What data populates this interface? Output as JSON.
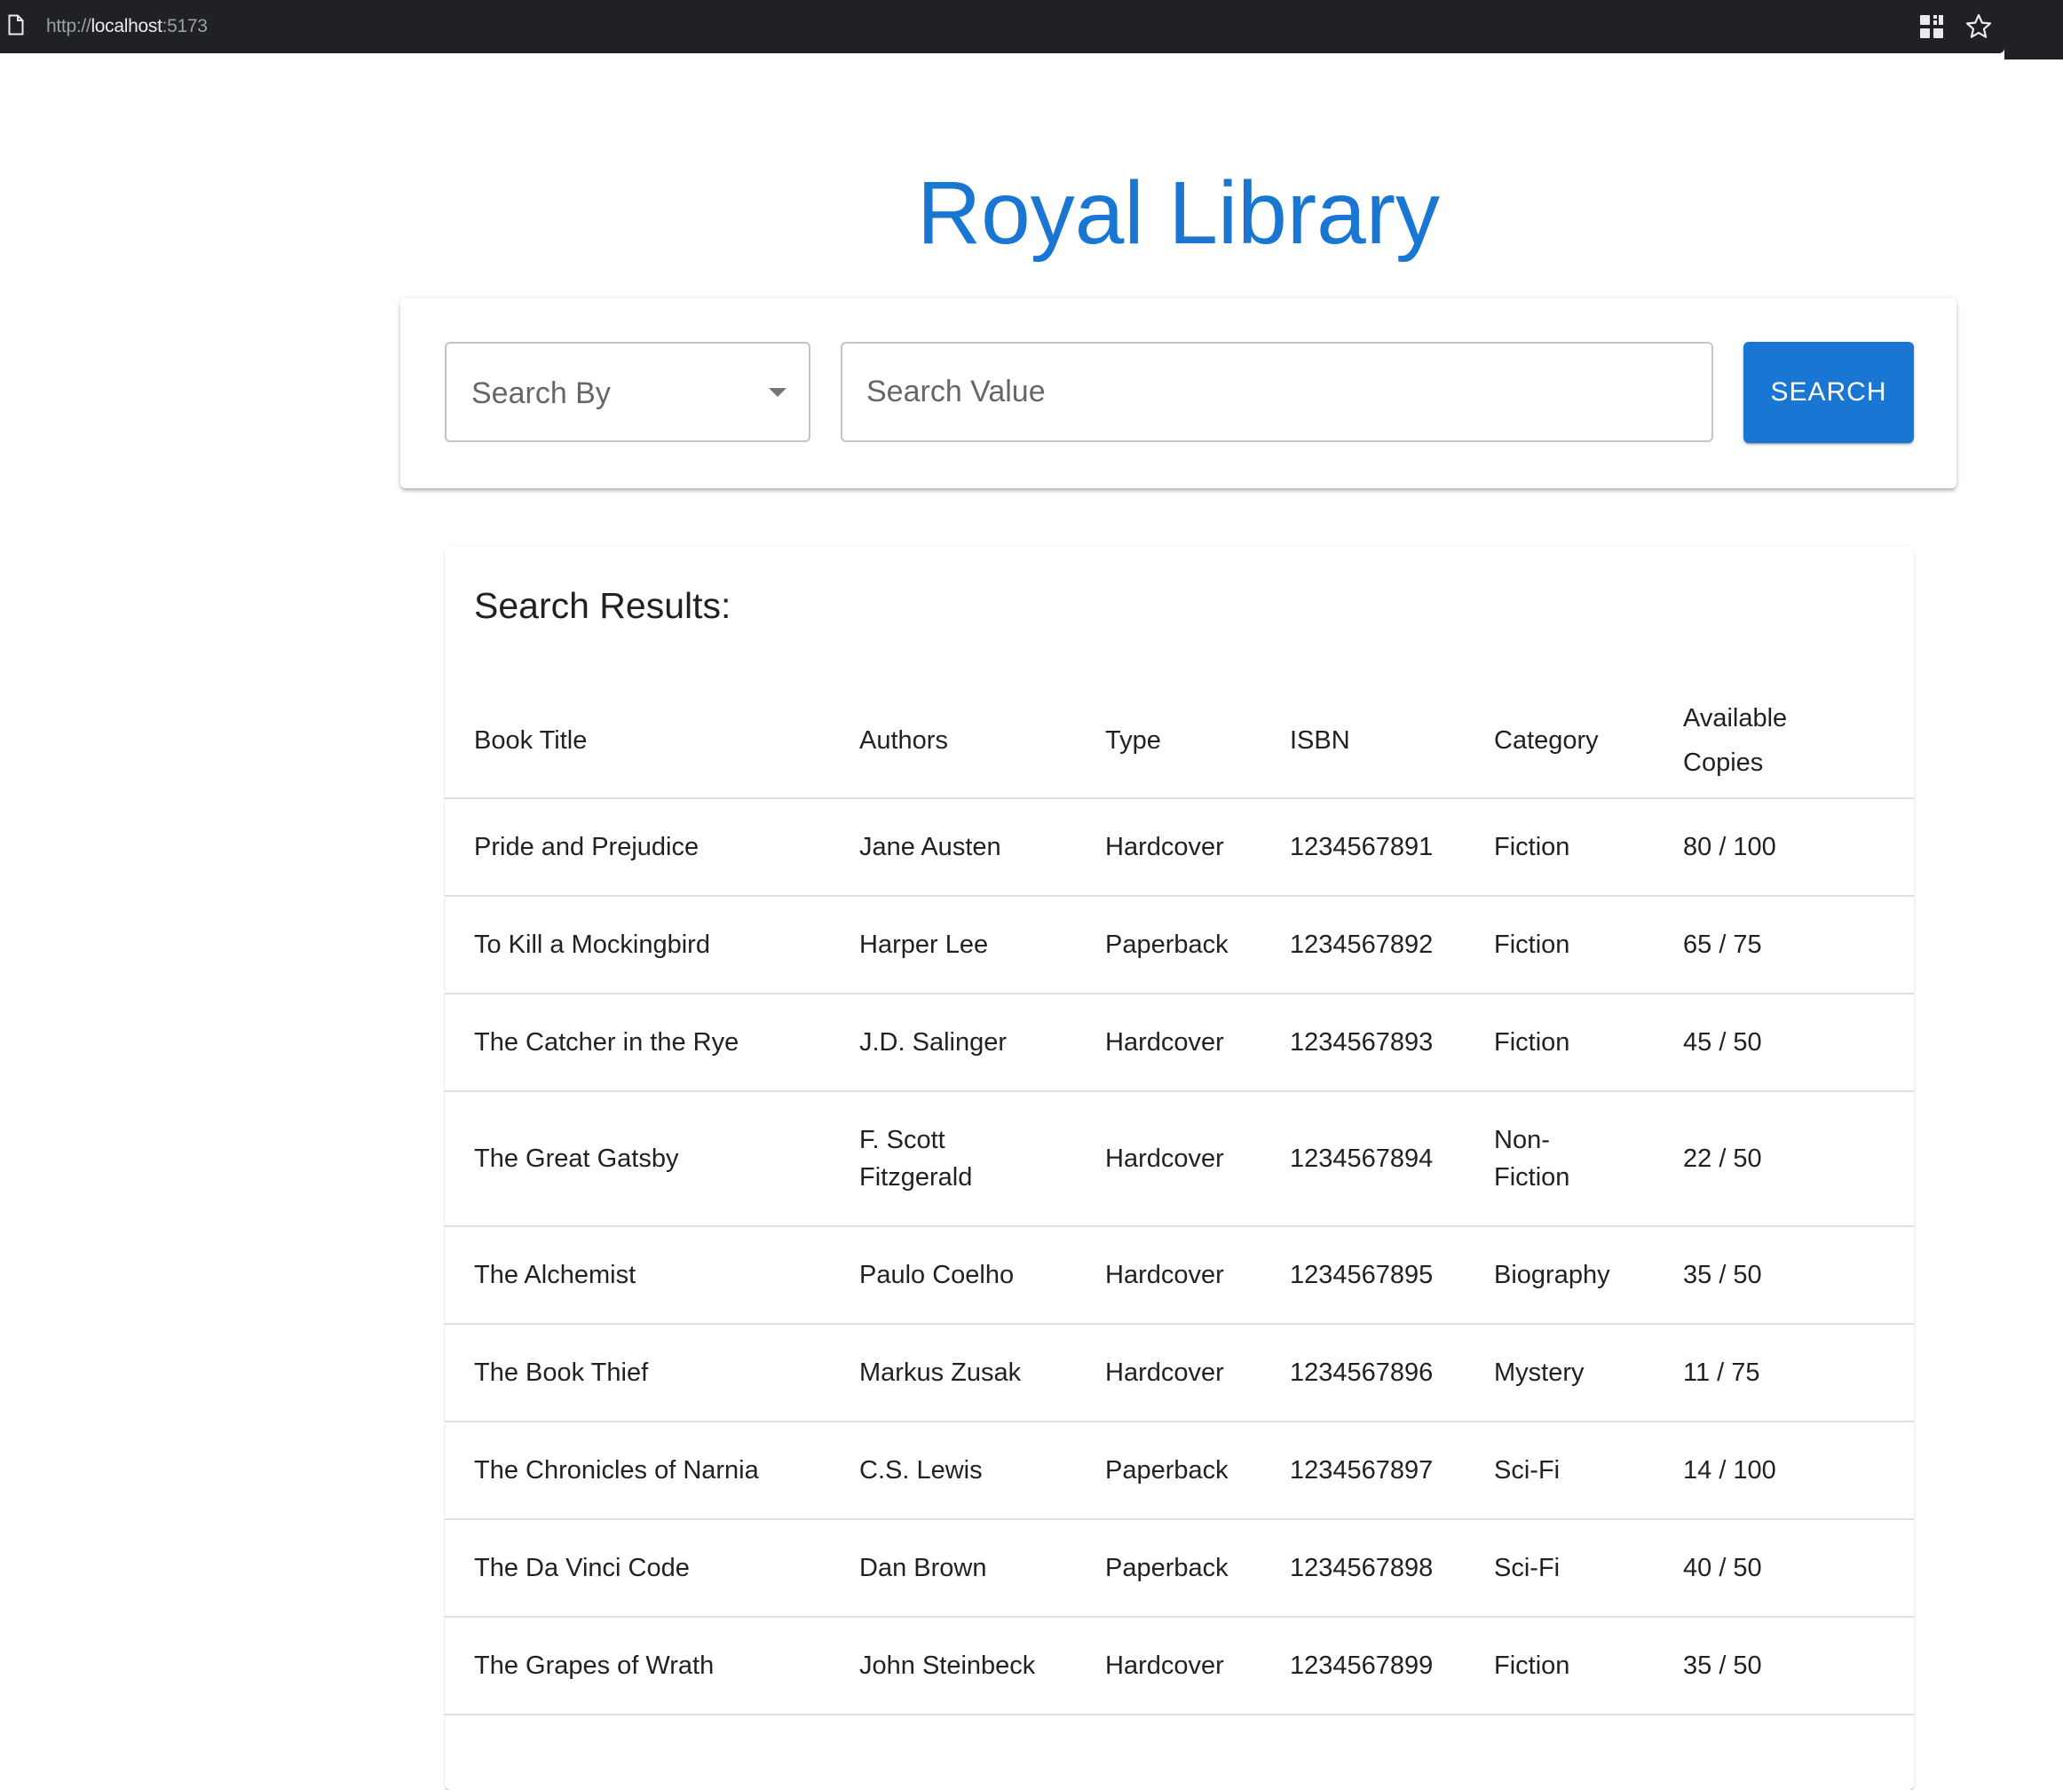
{
  "browser": {
    "url_scheme": "http://",
    "url_host": "localhost",
    "url_port": ":5173",
    "icons": [
      "page-icon",
      "grid-icon",
      "star-icon"
    ]
  },
  "header": {
    "title": "Royal Library"
  },
  "search": {
    "search_by_label": "Search By",
    "value_placeholder": "Search Value",
    "button_label": "SEARCH"
  },
  "results": {
    "heading": "Search Results:",
    "columns": [
      "Book Title",
      "Authors",
      "Type",
      "ISBN",
      "Category",
      "Available Copies"
    ],
    "rows": [
      {
        "title": "Pride and Prejudice",
        "authors": "Jane Austen",
        "type": "Hardcover",
        "isbn": "1234567891",
        "category": "Fiction",
        "copies": "80 / 100"
      },
      {
        "title": "To Kill a Mockingbird",
        "authors": "Harper Lee",
        "type": "Paperback",
        "isbn": "1234567892",
        "category": "Fiction",
        "copies": "65 / 75"
      },
      {
        "title": "The Catcher in the Rye",
        "authors": "J.D. Salinger",
        "type": "Hardcover",
        "isbn": "1234567893",
        "category": "Fiction",
        "copies": "45 / 50"
      },
      {
        "title": "The Great Gatsby",
        "authors": "F. Scott Fitzgerald",
        "type": "Hardcover",
        "isbn": "1234567894",
        "category": "Non-Fiction",
        "copies": "22 / 50"
      },
      {
        "title": "The Alchemist",
        "authors": "Paulo Coelho",
        "type": "Hardcover",
        "isbn": "1234567895",
        "category": "Biography",
        "copies": "35 / 50"
      },
      {
        "title": "The Book Thief",
        "authors": "Markus Zusak",
        "type": "Hardcover",
        "isbn": "1234567896",
        "category": "Mystery",
        "copies": "11 / 75"
      },
      {
        "title": "The Chronicles of Narnia",
        "authors": "C.S. Lewis",
        "type": "Paperback",
        "isbn": "1234567897",
        "category": "Sci-Fi",
        "copies": "14 / 100"
      },
      {
        "title": "The Da Vinci Code",
        "authors": "Dan Brown",
        "type": "Paperback",
        "isbn": "1234567898",
        "category": "Sci-Fi",
        "copies": "40 / 50"
      },
      {
        "title": "The Grapes of Wrath",
        "authors": "John Steinbeck",
        "type": "Hardcover",
        "isbn": "1234567899",
        "category": "Fiction",
        "copies": "35 / 50"
      }
    ]
  },
  "colors": {
    "accent": "#1976d2",
    "browser_bar": "#202124"
  }
}
